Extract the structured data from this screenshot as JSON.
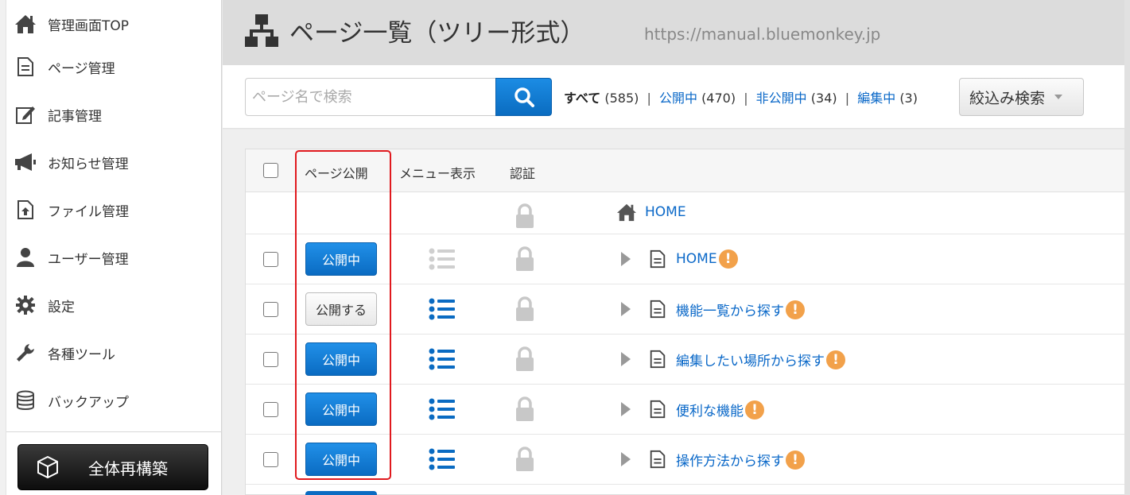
{
  "sidebar": {
    "items": [
      {
        "label": "管理画面TOP",
        "icon": "home-icon"
      },
      {
        "label": "ページ管理",
        "icon": "page-icon"
      },
      {
        "label": "記事管理",
        "icon": "edit-icon"
      },
      {
        "label": "お知らせ管理",
        "icon": "megaphone-icon"
      },
      {
        "label": "ファイル管理",
        "icon": "file-upload-icon"
      },
      {
        "label": "ユーザー管理",
        "icon": "user-icon"
      },
      {
        "label": "設定",
        "icon": "gear-icon"
      },
      {
        "label": "各種ツール",
        "icon": "wrench-icon"
      },
      {
        "label": "バックアップ",
        "icon": "database-icon"
      }
    ],
    "rebuild_label": "全体再構築"
  },
  "header": {
    "title": "ページ一覧（ツリー形式）",
    "url": "https://manual.bluemonkey.jp"
  },
  "filter": {
    "search_placeholder": "ページ名で検索",
    "all_label": "すべて",
    "all_count": "(585)",
    "published_label": "公開中",
    "published_count": "(470)",
    "unpublished_label": "非公開中",
    "unpublished_count": "(34)",
    "editing_label": "編集中",
    "editing_count": "(3)",
    "separator": "|",
    "narrow_label": "絞込み検索"
  },
  "table": {
    "headers": {
      "publish": "ページ公開",
      "menu": "メニュー表示",
      "auth": "認証"
    },
    "root": {
      "label": "HOME"
    },
    "rows": [
      {
        "status": "公開中",
        "published": true,
        "menu_visible": false,
        "label": "HOME",
        "warning": "!"
      },
      {
        "status": "公開する",
        "published": false,
        "menu_visible": true,
        "label": "機能一覧から探す",
        "warning": "!"
      },
      {
        "status": "公開中",
        "published": true,
        "menu_visible": true,
        "label": "編集したい場所から探す",
        "warning": "!"
      },
      {
        "status": "公開中",
        "published": true,
        "menu_visible": true,
        "label": "便利な機能",
        "warning": "!"
      },
      {
        "status": "公開中",
        "published": true,
        "menu_visible": true,
        "label": "操作方法から探す",
        "warning": "!"
      }
    ]
  },
  "colors": {
    "accent": "#0a6bc2",
    "link": "#0a68c8",
    "warning": "#f2a14a",
    "highlight": "#e0191e"
  }
}
